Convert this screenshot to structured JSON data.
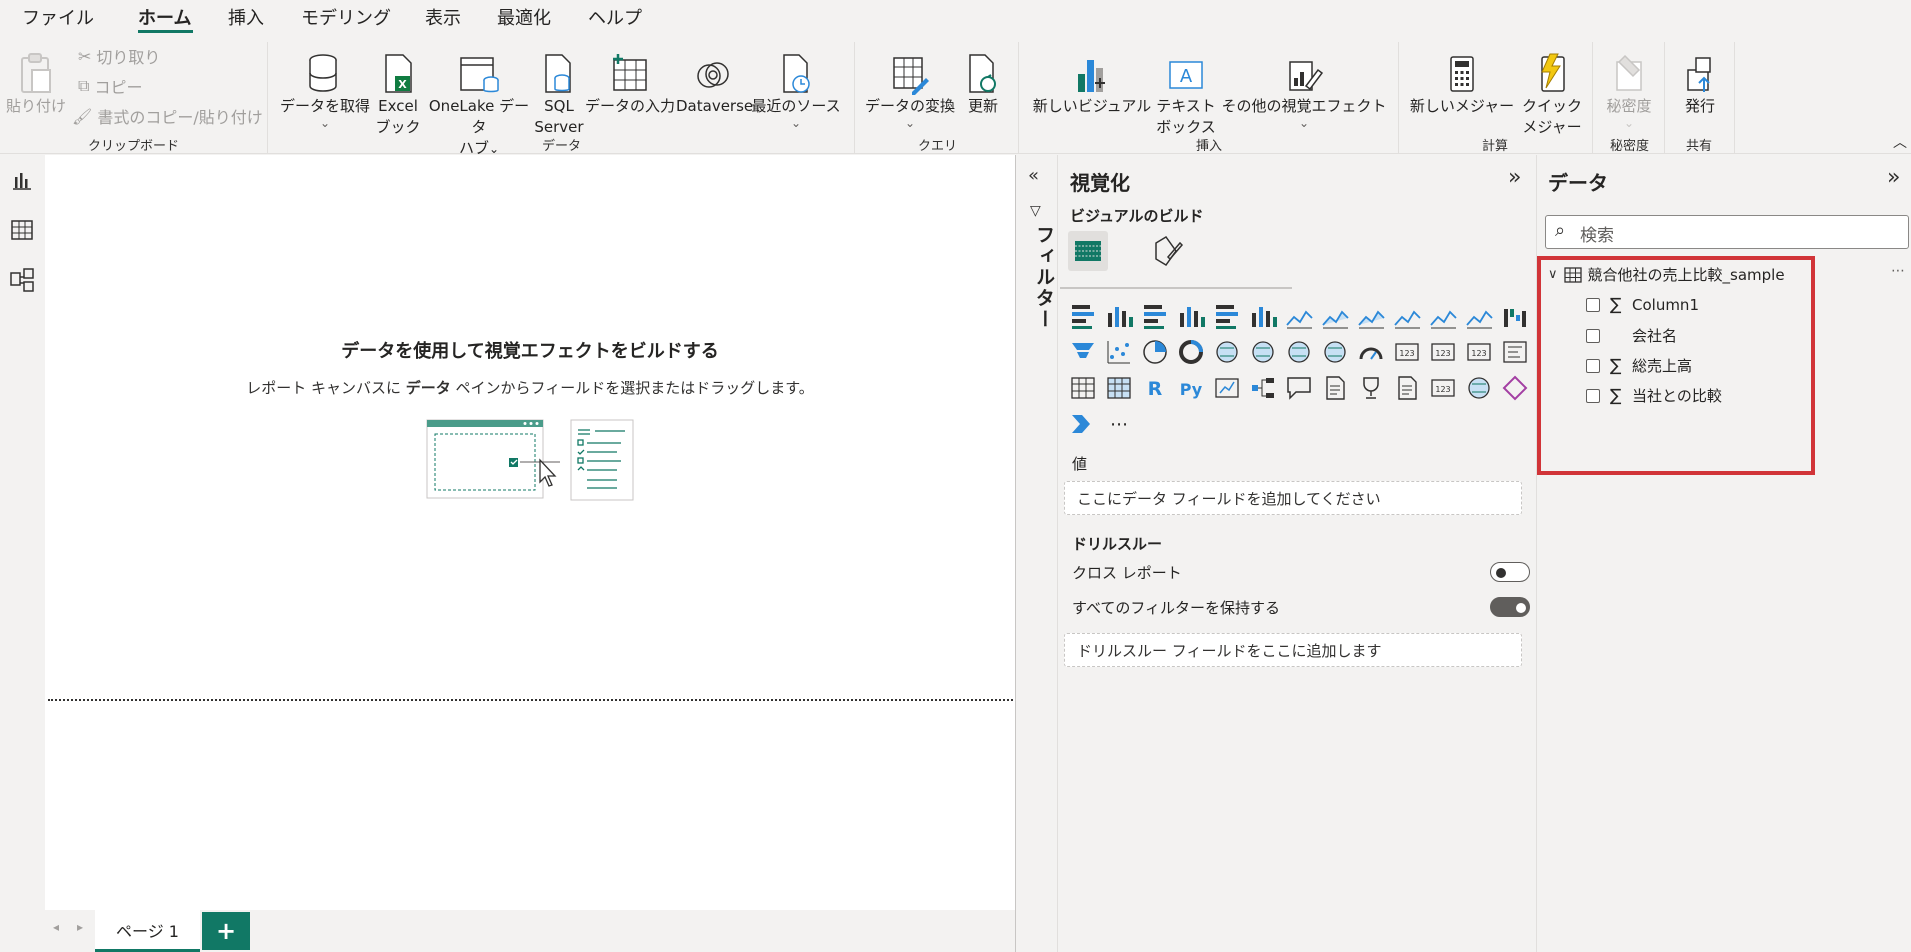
{
  "menu": {
    "tabs": [
      "ファイル",
      "ホーム",
      "挿入",
      "モデリング",
      "表示",
      "最適化",
      "ヘルプ"
    ],
    "active_tab": "ホーム"
  },
  "ribbon": {
    "clipboard": {
      "paste": "貼り付け",
      "cut": "切り取り",
      "copy": "コピー",
      "format_painter": "書式のコピー/貼り付け",
      "label": "クリップボード"
    },
    "data": {
      "get_data": "データを取得",
      "excel_line1": "Excel",
      "excel_line2": "ブック",
      "onelake_line1": "OneLake データ",
      "onelake_line2": "ハブ",
      "sql_line1": "SQL",
      "sql_line2": "Server",
      "enter_data": "データの入力",
      "dataverse": "Dataverse",
      "recent_sources": "最近のソース",
      "label": "データ"
    },
    "query": {
      "transform": "データの変換",
      "refresh": "更新",
      "label": "クエリ"
    },
    "insert": {
      "new_visual": "新しいビジュアル",
      "textbox_line1": "テキスト",
      "textbox_line2": "ボックス",
      "more_visuals": "その他の視覚エフェクト",
      "label": "挿入"
    },
    "calc": {
      "new_measure": "新しいメジャー",
      "quick_line1": "クイック",
      "quick_line2": "メジャー",
      "label": "計算"
    },
    "sensitivity": {
      "button": "秘密度",
      "label": "秘密度"
    },
    "share": {
      "publish": "発行",
      "label": "共有"
    }
  },
  "canvas": {
    "title": "データを使用して視覚エフェクトをビルドする",
    "subtitle_pre": "レポート キャンバスに ",
    "subtitle_bold": "データ",
    "subtitle_post": " ペインからフィールドを選択またはドラッグします。"
  },
  "pages": {
    "tab": "ページ 1",
    "add": "+"
  },
  "filters": {
    "label": "フィルター"
  },
  "viz_pane": {
    "title": "視覚化",
    "build_label": "ビジュアルのビルド",
    "values_label": "値",
    "values_placeholder": "ここにデータ フィールドを追加してください",
    "drill_label": "ドリルスルー",
    "cross_report": "クロス レポート",
    "cross_report_on": false,
    "keep_filters": "すべてのフィルターを保持する",
    "keep_filters_on": true,
    "drill_placeholder": "ドリルスルー フィールドをここに追加します",
    "more": "⋯",
    "visual_icons": [
      "stacked-bar-chart",
      "stacked-column-chart",
      "clustered-bar-chart",
      "clustered-column-chart",
      "100-stacked-bar-chart",
      "100-stacked-column-chart",
      "line-chart",
      "area-chart",
      "stacked-area-chart",
      "line-and-stacked-column-chart",
      "line-and-clustered-column-chart",
      "ribbon-chart",
      "waterfall-chart",
      "funnel-chart",
      "scatter-chart",
      "pie-chart",
      "donut-chart",
      "treemap",
      "map",
      "filled-map",
      "azure-map",
      "gauge",
      "card",
      "multi-row-card",
      "kpi",
      "slicer",
      "table",
      "matrix",
      "r-visual",
      "python-visual",
      "key-influencers",
      "decomposition-tree",
      "qa",
      "smart-narrative",
      "metrics",
      "paginated-report",
      "new-card",
      "arcgis-map",
      "power-apps",
      "power-automate"
    ],
    "r_text": "R",
    "py_text": "Py"
  },
  "data_pane": {
    "title": "データ",
    "search_placeholder": "検索",
    "table_name": "競合他社の売上比較_sample",
    "fields": [
      {
        "name": "Column1",
        "sigma": true
      },
      {
        "name": "会社名",
        "sigma": false
      },
      {
        "name": "総売上高",
        "sigma": true
      },
      {
        "name": "当社との比較",
        "sigma": true
      }
    ],
    "sigma": "∑",
    "more": "⋯"
  },
  "colors": {
    "accent": "#117865",
    "highlight": "#d13438"
  }
}
